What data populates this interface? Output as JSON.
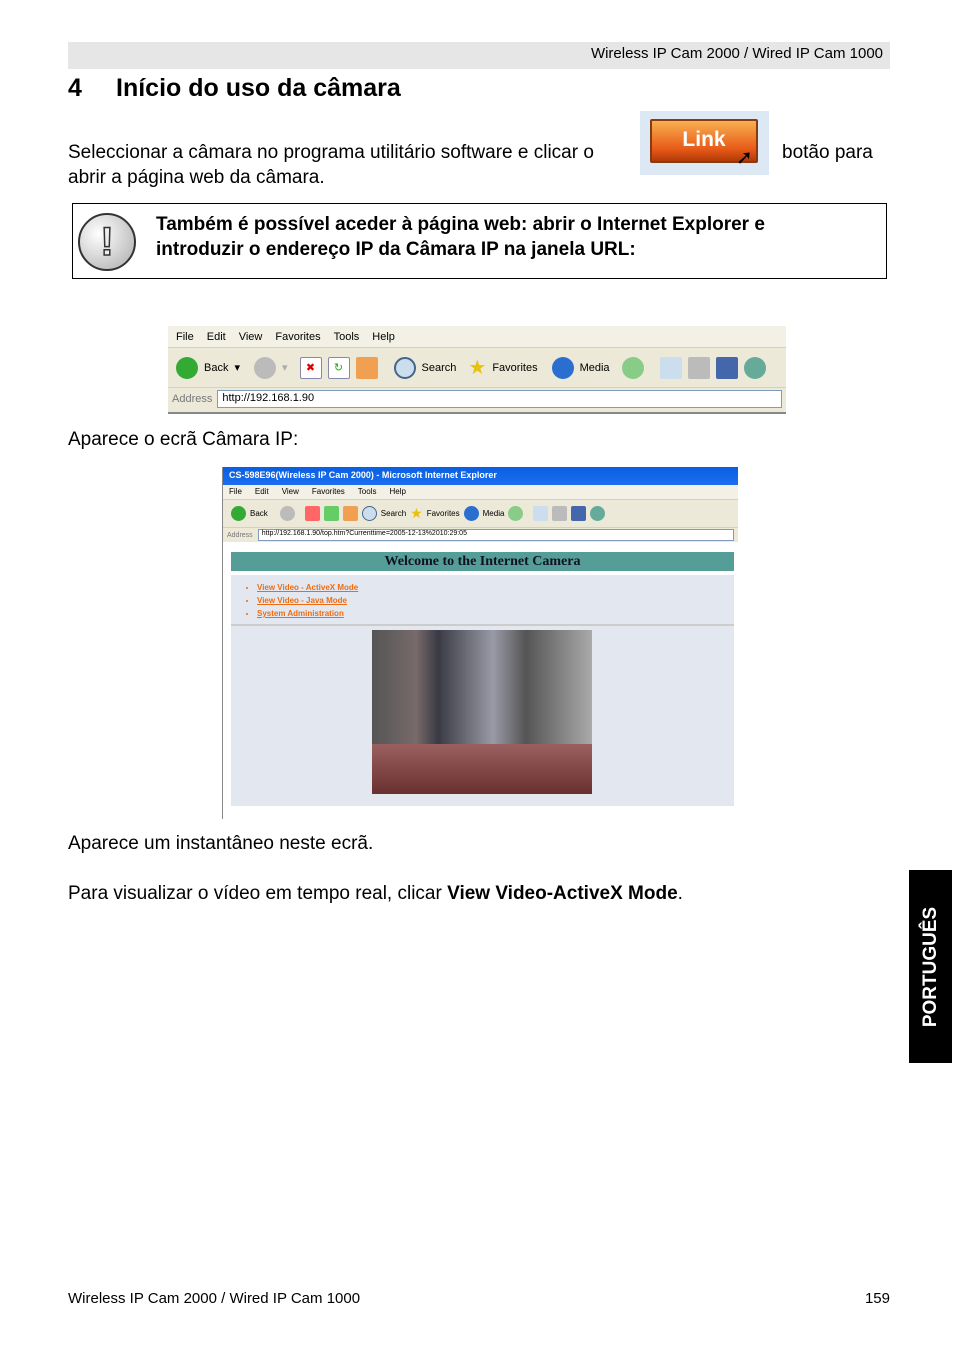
{
  "header": "Wireless IP Cam 2000 / Wired IP Cam 1000",
  "section": {
    "number": "4",
    "title": "Início do uso da câmara"
  },
  "intro": {
    "before": "Seleccionar a câmara no programa utilitário software e clicar o",
    "after": "botão para",
    "line2": "abrir a página web da câmara.",
    "button_label": "Link"
  },
  "note": {
    "line1": "Também é possível aceder à página web: abrir o Internet Explorer e",
    "line2": "introduzir o endereço IP da Câmara IP na janela URL:",
    "icon": "exclamation-icon"
  },
  "browser1": {
    "menu": [
      "File",
      "Edit",
      "View",
      "Favorites",
      "Tools",
      "Help"
    ],
    "toolbar": {
      "back": "Back",
      "search": "Search",
      "favorites": "Favorites",
      "media": "Media"
    },
    "address_label": "Address",
    "url": "http://192.168.1.90"
  },
  "caption1": "Aparece o ecrã Câmara IP:",
  "browser2": {
    "title": "CS-598E96(Wireless IP Cam 2000) - Microsoft Internet Explorer",
    "menu": [
      "File",
      "Edit",
      "View",
      "Favorites",
      "Tools",
      "Help"
    ],
    "toolbar": {
      "back": "Back",
      "search": "Search",
      "favorites": "Favorites",
      "media": "Media"
    },
    "address_label": "Address",
    "url": "http://192.168.1.90/top.htm?Currenttime=2005-12-13%2010:29:05",
    "welcome": "Welcome to the Internet Camera",
    "links": [
      "View Video - ActiveX Mode",
      "View Video - Java Mode",
      "System Administration"
    ]
  },
  "caption2": "Aparece um instantâneo neste ecrã.",
  "caption3": {
    "before": "Para visualizar o vídeo em tempo real, clicar ",
    "bold": "View Video-ActiveX Mode",
    "after": "."
  },
  "side_tab": "PORTUGUÊS",
  "footer": {
    "left": "Wireless IP Cam 2000 / Wired IP Cam 1000",
    "page": "159"
  }
}
